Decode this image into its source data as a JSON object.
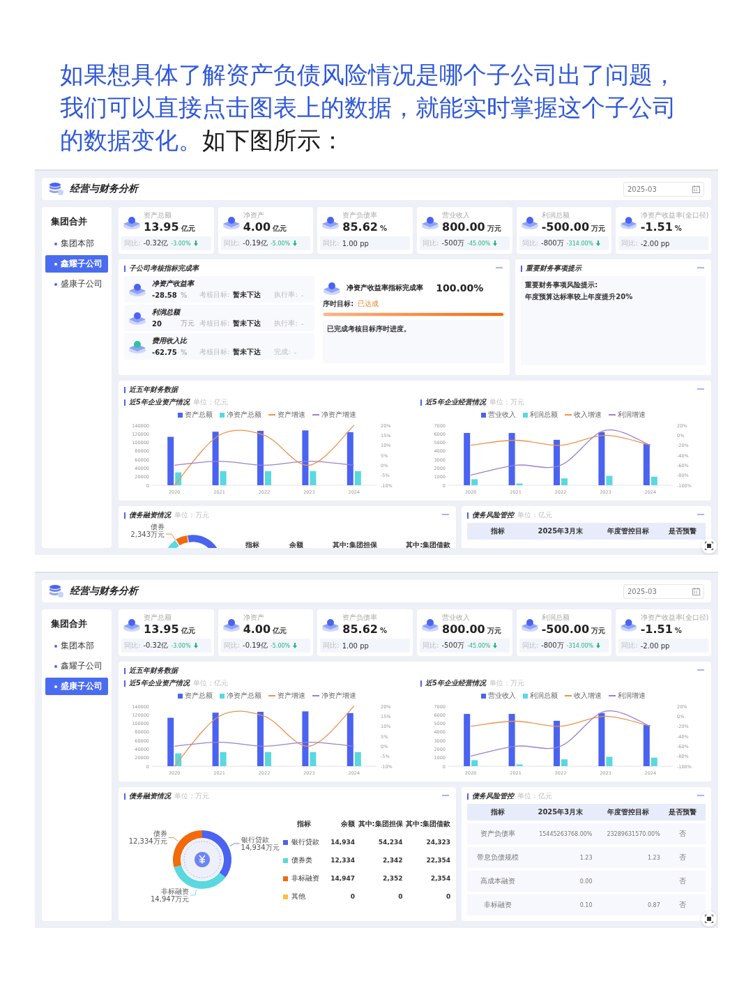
{
  "intro": {
    "highlight": "如果想具体了解资产负债风险情况是哪个子公司出了问题，我们可以直接点击图表上的数据，就能实时掌握这个子公司的数据变化。",
    "rest": "如下图所示："
  },
  "screens": [
    {
      "header": {
        "title": "经营与财务分析",
        "date": "2025-03"
      },
      "sidebar": {
        "title": "集团合并",
        "items": [
          {
            "label": "集团本部",
            "selected": false
          },
          {
            "label": "鑫耀子公司",
            "selected": true
          },
          {
            "label": "盛康子公司",
            "selected": false
          }
        ]
      },
      "kpis": [
        {
          "label": "资产总额",
          "value": "13.95",
          "unit": "亿元",
          "compare_label": "同比:",
          "delta": "-0.32亿",
          "pct": "-3.00%",
          "down": true
        },
        {
          "label": "净资产",
          "value": "4.00",
          "unit": "亿元",
          "compare_label": "同比:",
          "delta": "-0.19亿",
          "pct": "-5.00%",
          "down": true
        },
        {
          "label": "资产负债率",
          "value": "85.62",
          "unit": "%",
          "compare_label": "同比:",
          "delta": "1.00 pp"
        },
        {
          "label": "营业收入",
          "value": "800.00",
          "unit": "万元",
          "compare_label": "同比:",
          "delta": "-500万",
          "pct": "-45.00%",
          "down": true
        },
        {
          "label": "利润总额",
          "value": "-500.00",
          "unit": "万元",
          "compare_label": "同比:",
          "delta": "-800万",
          "pct": "-314.00%",
          "down": true
        },
        {
          "label": "净资产收益率(全口径)",
          "value": "-1.51",
          "unit": "%",
          "compare_label": "同比:",
          "delta": "-2.00 pp"
        }
      ],
      "assessment": {
        "title": "子公司考核指标完成率",
        "items": [
          {
            "name": "净资产收益率",
            "value": "-28.58",
            "unit": "%",
            "target_label": "考核目标:",
            "target": "暂未下达",
            "rate_label": "执行率:",
            "rate": "-"
          },
          {
            "name": "利润总额",
            "value": "20",
            "unit": "万元",
            "target_label": "考核目标:",
            "target": "暂未下达",
            "rate_label": "执行率:",
            "rate": "-"
          },
          {
            "name": "费用收入比",
            "value": "-62.75",
            "unit": "%",
            "target_label": "考核目标:",
            "target": "暂未下达",
            "rate_label": "完成:",
            "rate": "-"
          }
        ],
        "progress": {
          "title": "净资产收益率指标完成率",
          "value": "100.00%",
          "goal_label": "序时目标:",
          "goal": "已达成",
          "level": 1,
          "note": "已完成考核目标序时进度。"
        }
      },
      "notice": {
        "title": "重要财务事项提示",
        "heading": "重要财务事项风险提示:",
        "lines": [
          "年度预算达标率较上年度提升20%"
        ]
      },
      "five_year": {
        "title": "近五年财务数据",
        "charts": [
          {
            "subtitle": "近5年企业资产情况",
            "unit": "单位：亿元",
            "chart_data": {
              "type": "bar",
              "categories": [
                "2020",
                "2021",
                "2022",
                "2023",
                "2024"
              ],
              "ylim": [
                0,
                140000
              ],
              "yticks": [
                0,
                20000,
                40000,
                60000,
                80000,
                100000,
                120000,
                140000
              ],
              "series": [
                {
                  "name": "资产总额",
                  "color": "#4a63f0",
                  "values": [
                    113000,
                    125000,
                    127000,
                    128000,
                    124000
                  ]
                },
                {
                  "name": "净资产总额",
                  "color": "#5ad8e0",
                  "values": [
                    30000,
                    33000,
                    33000,
                    33000,
                    33000
                  ]
                }
              ]
            },
            "trend": {
              "chart_data": {
                "type": "line",
                "ylim": [
                  -10,
                  20
                ],
                "yticks": [
                  {
                    "value": 20,
                    "label": "20%"
                  },
                  {
                    "value": 15,
                    "label": "15%"
                  },
                  {
                    "value": 10,
                    "label": "10%"
                  },
                  {
                    "value": 5,
                    "label": "5%"
                  },
                  {
                    "value": 0,
                    "label": "0%"
                  },
                  {
                    "value": -5,
                    "label": "-5%"
                  },
                  {
                    "value": -10,
                    "label": "-10%"
                  }
                ],
                "series": [
                  {
                    "name": "资产增速",
                    "color": "#f0914a",
                    "values": [
                      -10,
                      15,
                      15,
                      0,
                      20
                    ]
                  },
                  {
                    "name": "净资产增速",
                    "color": "#9b7fcf",
                    "values": [
                      0,
                      2,
                      0,
                      2,
                      0
                    ]
                  }
                ]
              }
            }
          },
          {
            "subtitle": "近5年企业经营情况",
            "unit": "单位：万元",
            "chart_data": {
              "type": "bar",
              "categories": [
                "2020",
                "2021",
                "2022",
                "2023",
                "2024"
              ],
              "ylim": [
                0,
                7000
              ],
              "yticks": [
                0,
                1000,
                2000,
                3000,
                4000,
                5000,
                6000,
                7000
              ],
              "series": [
                {
                  "name": "营业收入",
                  "color": "#4a63f0",
                  "values": [
                    6100,
                    6100,
                    5300,
                    6200,
                    4800
                  ]
                },
                {
                  "name": "利润总额",
                  "color": "#5ad8e0",
                  "values": [
                    700,
                    200,
                    800,
                    1100,
                    1000
                  ]
                }
              ]
            },
            "trend": {
              "chart_data": {
                "type": "line",
                "ylim": [
                  -100,
                  20
                ],
                "yticks": [
                  {
                    "value": 20,
                    "label": "20%"
                  },
                  {
                    "value": 0,
                    "label": "0%"
                  },
                  {
                    "value": -20,
                    "label": "-20%"
                  },
                  {
                    "value": -40,
                    "label": "-40%"
                  },
                  {
                    "value": -60,
                    "label": "-60%"
                  },
                  {
                    "value": -80,
                    "label": "-80%"
                  },
                  {
                    "value": -100,
                    "label": "-100%"
                  }
                ],
                "series": [
                  {
                    "name": "收入增速",
                    "color": "#f0914a",
                    "values": [
                      -20,
                      -10,
                      -20,
                      0,
                      -20
                    ]
                  },
                  {
                    "name": "利润增速",
                    "color": "#9b7fcf",
                    "values": [
                      -80,
                      -60,
                      -60,
                      10,
                      -20
                    ]
                  }
                ]
              }
            }
          }
        ]
      },
      "financing": {
        "kind": "clipped",
        "title": "债务融资情况",
        "unit": "单位：万元",
        "callout": {
          "name": "债券",
          "value": "2,343万元"
        },
        "columns": [
          "指标",
          "余额",
          "其中:集团担保",
          "其中:集团借款"
        ]
      },
      "risk": {
        "title": "债务风险管控",
        "unit": "单位：亿元",
        "columns": [
          "指标",
          "2025年3月末",
          "年度管控目标",
          "是否预警"
        ]
      }
    },
    {
      "header": {
        "title": "经营与财务分析",
        "date": "2025-03"
      },
      "sidebar": {
        "title": "集团合并",
        "items": [
          {
            "label": "集团本部",
            "selected": false
          },
          {
            "label": "鑫耀子公司",
            "selected": false
          },
          {
            "label": "盛康子公司",
            "selected": true
          }
        ]
      },
      "kpis": [
        {
          "label": "资产总额",
          "value": "13.95",
          "unit": "亿元",
          "compare_label": "同比:",
          "delta": "-0.32亿",
          "pct": "-3.00%",
          "down": true
        },
        {
          "label": "净资产",
          "value": "4.00",
          "unit": "亿元",
          "compare_label": "同比:",
          "delta": "-0.19亿",
          "pct": "-5.00%",
          "down": true
        },
        {
          "label": "资产负债率",
          "value": "85.62",
          "unit": "%",
          "compare_label": "同比:",
          "delta": "1.00 pp"
        },
        {
          "label": "营业收入",
          "value": "800.00",
          "unit": "万元",
          "compare_label": "同比:",
          "delta": "-500万",
          "pct": "-45.00%",
          "down": true
        },
        {
          "label": "利润总额",
          "value": "-500.00",
          "unit": "万元",
          "compare_label": "同比:",
          "delta": "-800万",
          "pct": "-314.00%",
          "down": true
        },
        {
          "label": "净资产收益率(全口径)",
          "value": "-1.51",
          "unit": "%",
          "compare_label": "同比:",
          "delta": "-2.00 pp"
        }
      ],
      "five_year": {
        "title": "近五年财务数据",
        "charts": [
          {
            "subtitle": "近5年企业资产情况",
            "unit": "单位：亿元",
            "chart_data": {
              "type": "bar",
              "categories": [
                "2020",
                "2021",
                "2022",
                "2023",
                "2024"
              ],
              "ylim": [
                0,
                140000
              ],
              "yticks": [
                0,
                20000,
                40000,
                60000,
                80000,
                100000,
                120000,
                140000
              ],
              "series": [
                {
                  "name": "资产总额",
                  "color": "#4a63f0",
                  "values": [
                    113000,
                    125000,
                    127000,
                    128000,
                    124000
                  ]
                },
                {
                  "name": "净资产总额",
                  "color": "#5ad8e0",
                  "values": [
                    30000,
                    33000,
                    33000,
                    33000,
                    33000
                  ]
                }
              ]
            },
            "trend": {
              "chart_data": {
                "type": "line",
                "ylim": [
                  -10,
                  20
                ],
                "yticks": [
                  {
                    "value": 20,
                    "label": "20%"
                  },
                  {
                    "value": 15,
                    "label": "15%"
                  },
                  {
                    "value": 10,
                    "label": "10%"
                  },
                  {
                    "value": 5,
                    "label": "5%"
                  },
                  {
                    "value": 0,
                    "label": "0%"
                  },
                  {
                    "value": -5,
                    "label": "-5%"
                  },
                  {
                    "value": -10,
                    "label": "-10%"
                  }
                ],
                "series": [
                  {
                    "name": "资产增速",
                    "color": "#f0914a",
                    "values": [
                      -10,
                      15,
                      15,
                      0,
                      20
                    ]
                  },
                  {
                    "name": "净资产增速",
                    "color": "#9b7fcf",
                    "values": [
                      0,
                      2,
                      0,
                      2,
                      0
                    ]
                  }
                ]
              }
            }
          },
          {
            "subtitle": "近5年企业经营情况",
            "unit": "单位：万元",
            "chart_data": {
              "type": "bar",
              "categories": [
                "2020",
                "2021",
                "2022",
                "2023",
                "2024"
              ],
              "ylim": [
                0,
                7000
              ],
              "yticks": [
                0,
                1000,
                2000,
                3000,
                4000,
                5000,
                6000,
                7000
              ],
              "series": [
                {
                  "name": "营业收入",
                  "color": "#4a63f0",
                  "values": [
                    6100,
                    6100,
                    5300,
                    6200,
                    4800
                  ]
                },
                {
                  "name": "利润总额",
                  "color": "#5ad8e0",
                  "values": [
                    700,
                    200,
                    800,
                    1100,
                    1000
                  ]
                }
              ]
            },
            "trend": {
              "chart_data": {
                "type": "line",
                "ylim": [
                  -100,
                  20
                ],
                "yticks": [
                  {
                    "value": 20,
                    "label": "20%"
                  },
                  {
                    "value": 0,
                    "label": "0%"
                  },
                  {
                    "value": -20,
                    "label": "-20%"
                  },
                  {
                    "value": -40,
                    "label": "-40%"
                  },
                  {
                    "value": -60,
                    "label": "-60%"
                  },
                  {
                    "value": -80,
                    "label": "-80%"
                  },
                  {
                    "value": -100,
                    "label": "-100%"
                  }
                ],
                "series": [
                  {
                    "name": "收入增速",
                    "color": "#f0914a",
                    "values": [
                      -20,
                      -10,
                      -20,
                      0,
                      -20
                    ]
                  },
                  {
                    "name": "利润增速",
                    "color": "#9b7fcf",
                    "values": [
                      -80,
                      -60,
                      -60,
                      10,
                      -20
                    ]
                  }
                ]
              }
            }
          }
        ]
      },
      "financing": {
        "kind": "full",
        "title": "债务融资情况",
        "unit": "单位：万元",
        "columns": [
          "指标",
          "余额",
          "其中:集团担保",
          "其中:集团借款"
        ],
        "rows": [
          {
            "name": "银行贷款",
            "color": "#4a63f0",
            "balance": "14,934",
            "guarantee": "54,234",
            "loan": "24,323"
          },
          {
            "name": "债券类",
            "color": "#5ad8e0",
            "balance": "12,334",
            "guarantee": "2,342",
            "loan": "22,354"
          },
          {
            "name": "非标融资",
            "color": "#f26a0c",
            "balance": "14,947",
            "guarantee": "2,352",
            "loan": "2,354"
          },
          {
            "name": "其他",
            "color": "#f5c242",
            "balance": "0",
            "guarantee": "0",
            "loan": "0"
          }
        ],
        "chart_data": {
          "type": "donut",
          "categories": [
            "银行贷款",
            "非标融资",
            "债券"
          ],
          "values": [
            14934,
            14947,
            12334
          ],
          "value_labels": [
            "14,934万元",
            "14,947万元",
            "12,334万元"
          ]
        }
      },
      "risk": {
        "title": "债务风险管控",
        "unit": "单位：亿元",
        "columns": [
          "指标",
          "2025年3月末",
          "年度管控目标",
          "是否预警"
        ],
        "rows": [
          {
            "name": "资产负债率",
            "actual": "15445263768.00%",
            "target": "23289631570.00%",
            "warning": "否"
          },
          {
            "name": "带息负债规模",
            "actual": "1.23",
            "target": "1.23",
            "warning": "否"
          },
          {
            "name": "高成本融资",
            "actual": "0.00",
            "warning": "否"
          },
          {
            "name": "非标融资",
            "actual": "0.10",
            "target": "0.87",
            "warning": "否"
          }
        ]
      }
    }
  ]
}
